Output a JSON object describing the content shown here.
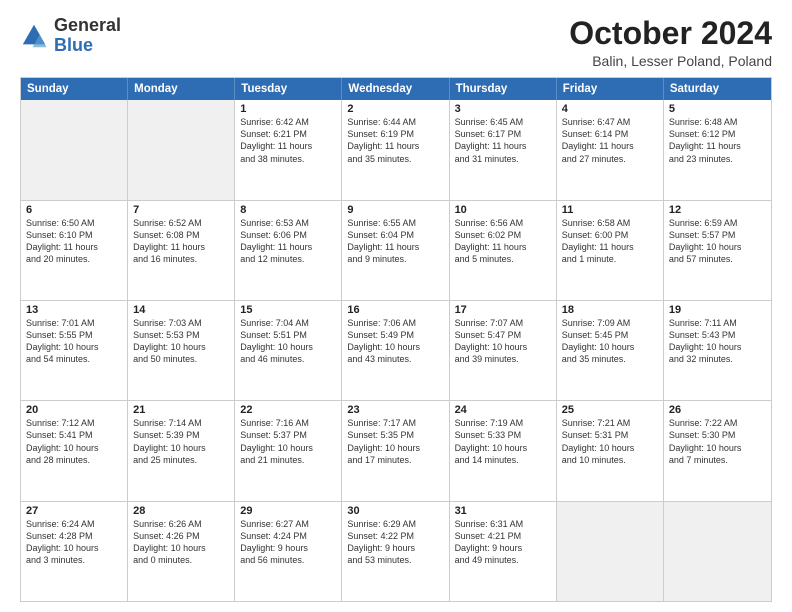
{
  "logo": {
    "general": "General",
    "blue": "Blue"
  },
  "header": {
    "title": "October 2024",
    "location": "Balin, Lesser Poland, Poland"
  },
  "days": [
    "Sunday",
    "Monday",
    "Tuesday",
    "Wednesday",
    "Thursday",
    "Friday",
    "Saturday"
  ],
  "weeks": [
    [
      {
        "day": "",
        "content": ""
      },
      {
        "day": "",
        "content": ""
      },
      {
        "day": "1",
        "content": "Sunrise: 6:42 AM\nSunset: 6:21 PM\nDaylight: 11 hours\nand 38 minutes."
      },
      {
        "day": "2",
        "content": "Sunrise: 6:44 AM\nSunset: 6:19 PM\nDaylight: 11 hours\nand 35 minutes."
      },
      {
        "day": "3",
        "content": "Sunrise: 6:45 AM\nSunset: 6:17 PM\nDaylight: 11 hours\nand 31 minutes."
      },
      {
        "day": "4",
        "content": "Sunrise: 6:47 AM\nSunset: 6:14 PM\nDaylight: 11 hours\nand 27 minutes."
      },
      {
        "day": "5",
        "content": "Sunrise: 6:48 AM\nSunset: 6:12 PM\nDaylight: 11 hours\nand 23 minutes."
      }
    ],
    [
      {
        "day": "6",
        "content": "Sunrise: 6:50 AM\nSunset: 6:10 PM\nDaylight: 11 hours\nand 20 minutes."
      },
      {
        "day": "7",
        "content": "Sunrise: 6:52 AM\nSunset: 6:08 PM\nDaylight: 11 hours\nand 16 minutes."
      },
      {
        "day": "8",
        "content": "Sunrise: 6:53 AM\nSunset: 6:06 PM\nDaylight: 11 hours\nand 12 minutes."
      },
      {
        "day": "9",
        "content": "Sunrise: 6:55 AM\nSunset: 6:04 PM\nDaylight: 11 hours\nand 9 minutes."
      },
      {
        "day": "10",
        "content": "Sunrise: 6:56 AM\nSunset: 6:02 PM\nDaylight: 11 hours\nand 5 minutes."
      },
      {
        "day": "11",
        "content": "Sunrise: 6:58 AM\nSunset: 6:00 PM\nDaylight: 11 hours\nand 1 minute."
      },
      {
        "day": "12",
        "content": "Sunrise: 6:59 AM\nSunset: 5:57 PM\nDaylight: 10 hours\nand 57 minutes."
      }
    ],
    [
      {
        "day": "13",
        "content": "Sunrise: 7:01 AM\nSunset: 5:55 PM\nDaylight: 10 hours\nand 54 minutes."
      },
      {
        "day": "14",
        "content": "Sunrise: 7:03 AM\nSunset: 5:53 PM\nDaylight: 10 hours\nand 50 minutes."
      },
      {
        "day": "15",
        "content": "Sunrise: 7:04 AM\nSunset: 5:51 PM\nDaylight: 10 hours\nand 46 minutes."
      },
      {
        "day": "16",
        "content": "Sunrise: 7:06 AM\nSunset: 5:49 PM\nDaylight: 10 hours\nand 43 minutes."
      },
      {
        "day": "17",
        "content": "Sunrise: 7:07 AM\nSunset: 5:47 PM\nDaylight: 10 hours\nand 39 minutes."
      },
      {
        "day": "18",
        "content": "Sunrise: 7:09 AM\nSunset: 5:45 PM\nDaylight: 10 hours\nand 35 minutes."
      },
      {
        "day": "19",
        "content": "Sunrise: 7:11 AM\nSunset: 5:43 PM\nDaylight: 10 hours\nand 32 minutes."
      }
    ],
    [
      {
        "day": "20",
        "content": "Sunrise: 7:12 AM\nSunset: 5:41 PM\nDaylight: 10 hours\nand 28 minutes."
      },
      {
        "day": "21",
        "content": "Sunrise: 7:14 AM\nSunset: 5:39 PM\nDaylight: 10 hours\nand 25 minutes."
      },
      {
        "day": "22",
        "content": "Sunrise: 7:16 AM\nSunset: 5:37 PM\nDaylight: 10 hours\nand 21 minutes."
      },
      {
        "day": "23",
        "content": "Sunrise: 7:17 AM\nSunset: 5:35 PM\nDaylight: 10 hours\nand 17 minutes."
      },
      {
        "day": "24",
        "content": "Sunrise: 7:19 AM\nSunset: 5:33 PM\nDaylight: 10 hours\nand 14 minutes."
      },
      {
        "day": "25",
        "content": "Sunrise: 7:21 AM\nSunset: 5:31 PM\nDaylight: 10 hours\nand 10 minutes."
      },
      {
        "day": "26",
        "content": "Sunrise: 7:22 AM\nSunset: 5:30 PM\nDaylight: 10 hours\nand 7 minutes."
      }
    ],
    [
      {
        "day": "27",
        "content": "Sunrise: 6:24 AM\nSunset: 4:28 PM\nDaylight: 10 hours\nand 3 minutes."
      },
      {
        "day": "28",
        "content": "Sunrise: 6:26 AM\nSunset: 4:26 PM\nDaylight: 10 hours\nand 0 minutes."
      },
      {
        "day": "29",
        "content": "Sunrise: 6:27 AM\nSunset: 4:24 PM\nDaylight: 9 hours\nand 56 minutes."
      },
      {
        "day": "30",
        "content": "Sunrise: 6:29 AM\nSunset: 4:22 PM\nDaylight: 9 hours\nand 53 minutes."
      },
      {
        "day": "31",
        "content": "Sunrise: 6:31 AM\nSunset: 4:21 PM\nDaylight: 9 hours\nand 49 minutes."
      },
      {
        "day": "",
        "content": ""
      },
      {
        "day": "",
        "content": ""
      }
    ]
  ]
}
